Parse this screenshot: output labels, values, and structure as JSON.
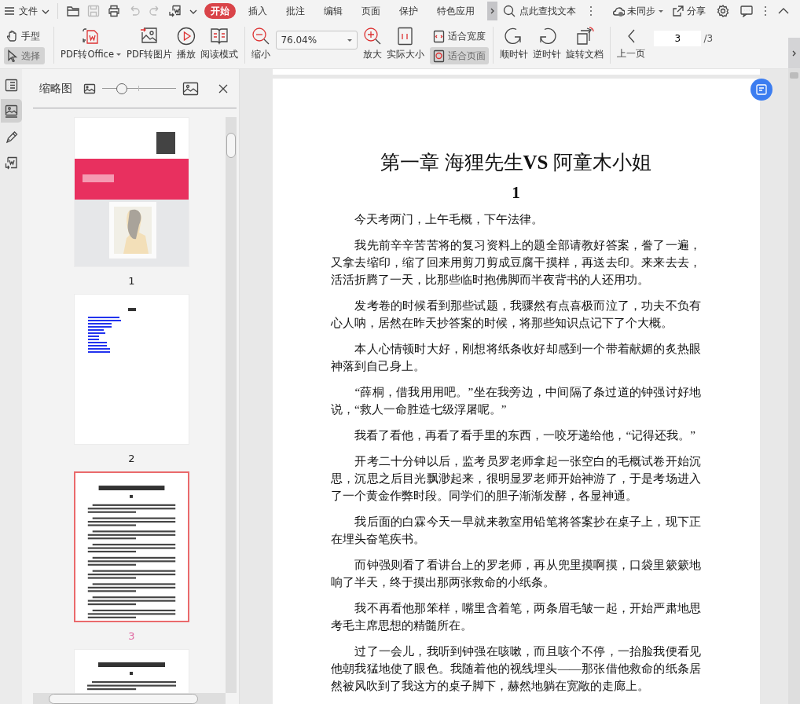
{
  "toolbar": {
    "menu": "文件",
    "quick_actions": [
      {
        "disabled": false
      },
      {
        "disabled": true
      },
      {
        "disabled": false
      },
      {
        "disabled": true
      },
      {
        "disabled": true
      },
      {
        "disabled": false
      }
    ],
    "tabs": [
      {
        "label": "开始",
        "selected": true
      },
      {
        "label": "插入",
        "selected": false
      },
      {
        "label": "批注",
        "selected": false
      },
      {
        "label": "编辑",
        "selected": false
      },
      {
        "label": "页面",
        "selected": false
      },
      {
        "label": "保护",
        "selected": false
      },
      {
        "label": "特色应用",
        "selected": false
      }
    ],
    "search": {
      "placeholder": "点此查找文本"
    },
    "sync": "未同步",
    "share": "分享"
  },
  "ribbon": {
    "modes": [
      {
        "label": "手型",
        "selected": false
      },
      {
        "label": "选择",
        "selected": true
      }
    ],
    "convert": [
      {
        "label": "PDF转Office",
        "has_menu": true
      },
      {
        "label": "PDF转图片"
      },
      {
        "label": "播放"
      },
      {
        "label": "阅读模式"
      }
    ],
    "zoom_out": "缩小",
    "zoom": {
      "value": "76.04%"
    },
    "zoom_in": "放大",
    "actual_size": "实际大小",
    "fit": [
      {
        "label": "适合宽度",
        "selected": false
      },
      {
        "label": "适合页面",
        "selected": true
      }
    ],
    "rotate": [
      {
        "label": "顺时针"
      },
      {
        "label": "逆时针"
      },
      {
        "label": "旋转文档"
      }
    ],
    "prev_page": "上一页",
    "page": {
      "value": "3",
      "total": "/3"
    }
  },
  "sidebar": {
    "rail": [
      {
        "selected": false
      },
      {
        "selected": true
      },
      {
        "selected": false
      },
      {
        "selected": false
      }
    ],
    "thumbnails": {
      "title": "缩略图",
      "size": {
        "level": 0.27
      },
      "pages": [
        {
          "kind": "cover",
          "label": "1",
          "selected": false
        },
        {
          "kind": "toc",
          "label": "2",
          "selected": false
        },
        {
          "kind": "text",
          "label": "3",
          "selected": true
        },
        {
          "kind": "text",
          "selected": false
        }
      ]
    }
  },
  "document": {
    "title": "第一章 海狸先生**VS** 阿童木小姐",
    "section": "1",
    "paragraphs": [
      "今天考两门，上午毛概，下午法律。",
      "我先前辛辛苦苦将的复习资料上的题全部请教好答案，誊了一遍，又拿去缩印，缩了回来用剪刀剪成豆腐干摸样，再送去印。来来去去，活活折腾了一天，比那些临时抱佛脚而半夜背书的人还用功。",
      "发考卷的时候看到那些试题，我骤然有点喜极而泣了，功夫不负有心人呐，居然在昨天抄答案的时候，将那些知识点记下了个大概。",
      "本人心情顿时大好，刚想将纸条收好却感到一个带着献媚的炙热眼神落到自己身上。",
      "“薛桐，借我用用吧。”坐在我旁边，中间隔了条过道的钟强讨好地说，“救人一命胜造七级浮屠呢。”",
      "我看了看他，再看了看手里的东西，一咬牙递给他，“记得还我。”",
      "开考二十分钟以后，监考员罗老师拿起一张空白的毛概试卷开始沉思，沉思之后目光飘渺起来，很明显罗老师开始神游了，于是考场进入了一个黄金作弊时段。同学们的胆子渐渐发酵，各显神通。",
      "我后面的白霖今天一早就来教室用铅笔将答案抄在桌子上，现下正在埋头奋笔疾书。",
      "而钟强则看了看讲台上的罗老师，再从兜里摸啊摸，口袋里簌簌地响了半天，终于摸出那两张救命的小纸条。",
      "我不再看他那笨样，嘴里含着笔，两条眉毛皱一起，开始严肃地思考毛主席思想的精髓所在。",
      "过了一会儿，我听到钟强在咳嗽，而且咳个不停，一抬脸我便看见他朝我猛地使了眼色。我随着他的视线埋头——那张借他救命的纸条居然被风吹到了我这方的桌子脚下，赫然地躺在宽敞的走廊上。"
    ]
  }
}
